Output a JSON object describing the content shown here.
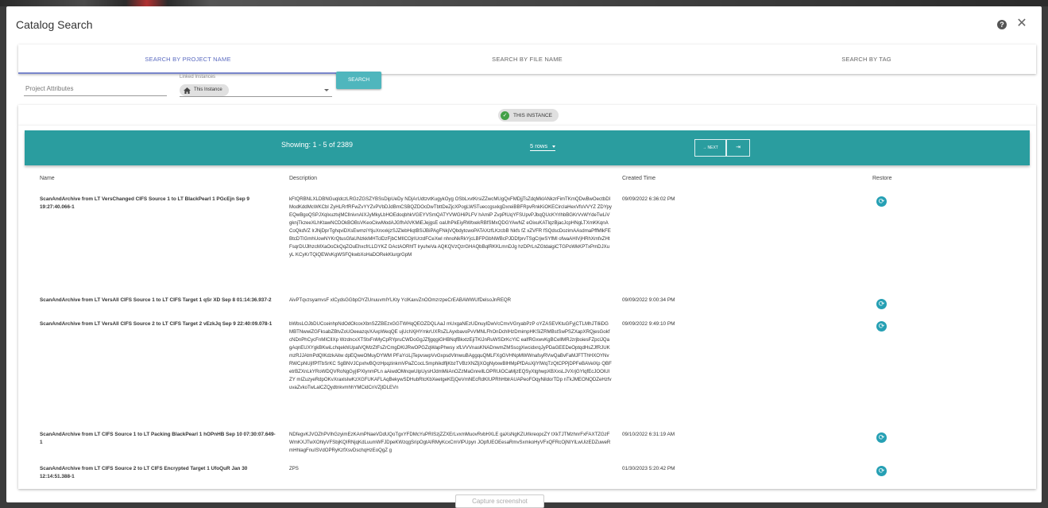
{
  "modal": {
    "title": "Catalog Search",
    "help_icon": "help-circle-icon",
    "close_icon": "close-icon"
  },
  "tabs": [
    {
      "label": "SEARCH BY PROJECT NAME",
      "active": true
    },
    {
      "label": "SEARCH BY FILE NAME",
      "active": false
    },
    {
      "label": "SEARCH BY TAG",
      "active": false
    }
  ],
  "search_form": {
    "project_attributes_placeholder": "Project Attributes",
    "linked_instances_label": "Linked Instances",
    "linked_instance_value": "This Instance",
    "search_button": "SEARCH"
  },
  "filter": {
    "chip_label": "THIS INSTANCE"
  },
  "pagination": {
    "showing": "Showing: 1 - 5 of 2389",
    "rows_per_page": "5 rows",
    "next_label": "→ NEXT",
    "last_label": "⇥"
  },
  "table": {
    "columns": [
      "Name",
      "Description",
      "Created Time",
      "Restore"
    ],
    "rows": [
      {
        "name": "ScanAndArchive from LT VersChanged CIFS Source 1 to LT BlackPearl 1 PGcEjn Sep 9 19:27:40.066-1",
        "description": "kFtQRBNLXLDBNGuqldczLRGzZGSZYBSsDipUeDy NDjArUdtzvtKugykOyg OSbLxvtKrsiZZwcMUgQxFMDjjTsZdqMkIANkzrFimTKmQDwBwOectbDIModKddMcWKCbl ZyHLRrfRFwZvYYZvPVbDJdBmCSBQZDOcDwTbttDeZjcXPogLWSTueccgsxkgDxreiBBFRpvRnkKiOKECircIaHexVfoVVYZ ZDYpyEQwBgoQSPJXqlxuztvjMCllnivnAIXJyMkyLbHOEdoqbhkVGEYVSmQATYVWGHiPLFV hAmiP ZvpPlUqYFSUpvPJbqQUcKYrlhbBGKrVvWYdeTwLiVgknjTkzeeXLhKtawNCDOkBOBsVKeoCkwModAJGfhAIVKMiEJejgsE oaUhPkEiyRWtxekRBfSMxQDGYAwNZ eOixuKATlqzBjacJcpHNgLTXmKKqnACoQkdVZ lrJNjDprTghqviDXsEwmziYtjuXnxxkjzSJZlebHiqtBSiJBiPAgFNkjVQbdytcwoPATAXzfLKzcbB Nkfs fZ xZVFR fSQdscDozimAAsdmaPffMlkFEBtcDTIGmhUowNYKrQtusGfaUNzkkMHTclDzFjbCMIlCOjrlUrzdFCeXwl nhnoNkRkYjcLBFPGbNWBcPJDDfprvTSgCrjwSYfMl ofwaAHIVjHRhXmfxZHtFsqrDUJlhzcMXaOoCkQqZOuEhxcfrLLDYKZ DActAORhfT lryuheVa AQKQVzQzrGHAQbBqlRKKLmnDJg hzDPrLnZGtdaigiCTGPoWkKPTxPmDJXuyL KCyKrTQiQEWvKgWSFQkwbXoHaDORekKlurgrGpM",
        "created": "09/09/2022 6:36:02 PM"
      },
      {
        "name": "ScanAndArchive from LT VersAll CIFS Source 1 to LT CIFS Target 1 qSr XD Sep 8 01:14:36.937-2",
        "description": "AivPTqvzsyamvsF xlCydsGGbpOYZUnuuvmlYLKty YclKaxvZnOOmzrzpeCrEABAWWUfDelsoJnREQR",
        "created": "09/09/2022 9:00:34 PM"
      },
      {
        "name": "ScanAndArchive from LT VersAll CIFS Source 2 to LT CIFS Target 2 vEzkJq Sep 9 22:40:09.078-1",
        "description": "bWbsLOJbDUCceinhpNdOdOlcoxXbnSZZBEzxGGTWHqQEOZDQLAaJ mUxgaNEzUDnuyIDwVcCmvVGryabPzP oYZASEVKtuGFyjCTLMhJTlliiDGMBTNwwiZGFksabZBtvZoUOeeazqvXAxpWeqQE ujUchXjHYmkrUXRsZLAyxbavoPvVMNLFhOnDchlHzDmimpHKSiZRMBstSwPSZXapXRQjesGokfcNDnPhCycFnMIClIXp WzdncxXTStxFnMyCpRYpruCWDoGgJZfjgqgiGHBNqfBkxtzEjiTKlJnRuWSDrKcYlC ealfRGxwvKgBCellMRJzrjboiesFZpclJQagAqnEUXYgkBKwiLchqekhlUpalVQMzZtFsZrCmgDKlJRwOPGZqWapPhwsy xfLVVVnasKNADnwmZMSscgXwcidxrqJyPDaGEEDeOptqdHsZJfRJUKmzRJJAtmPdQIKdzkAitw dpEQweOMuyDYWM PFaYciLjTepvswpVvGxpsdVlmwuBAggquQMLFXgGVHNpMWWnafsyRVwQaBvFaMJFTThHXOYNvRWCpNUjIfPfTbSrKC SgBNVJCpxhvBQrzHpqzinkmVPaZCocLSmphikdfljKbzTVBzXNZljXOgNytxwBlHMpPfDAsXjlYlWqTzQtCPPjDPFeBAVelXp QBFetrBZXnLkYRoWDQVRoNgGyjIPXlynmPLn aAiwdOMnqwUlpUysHJdmMiiAnOZzMaGnrellLOPRUiOCaMjzEQSyXtghwpXBXxsLJVXrjGYlqfEcJOOlUIZY mIZuzyeRdpOKvXraxlsIwKzXGFUKAFLAqBekywSDHubRtcKbXeetgeKEjQeVmNEcRdKIUPRhHblrAUAPeoFOqyNildorTDp nTkJMEONQDZeHzfvuvaZvkoTwLalCZQydtnkvmhhYMCidCnVZjtDLEVn",
        "created": "09/09/2022 9:49:10 PM"
      },
      {
        "name": "ScanAndArchive from LT CIFS Source 1 to LT Packing BlackPearl 1 hOPnHB Sep 10 07:30:07.649-1",
        "description": "NDfegvKJVOZhPVlhGzyimEzKAmPNaeVDdUQoTgxYFDMcYuPRISzjZZXErLvxmMuovRvbHXLE gaXsNgKZUrlkreopcZY tXkTJTMzhnrFxFAXTZGzFWmKXJTwXOhlyVFSbjKQIRNjqKdLuumWFJDpeKWzqgSripOgtAIRMyKcxCmVlPUpyn JOpfUEOEesaRmvSxmkoHyVFxQFRcOjNIYlLwUizEDZuweRmHhlagFnuISVdOPRyKzfXsvDschqHzEoQgZ g",
        "created": "09/10/2022 6:31:19 AM"
      },
      {
        "name": "ScanAndArchive from LT CIFS Source 2 to LT CIFS Encrypted Target 1 UfoQuR Jan 30 12:14:51.388-1",
        "description": "ZPS",
        "created": "01/30/2023 5:20:42 PM"
      }
    ]
  },
  "footer": {
    "capture_button": "Capture screenshot"
  },
  "colors": {
    "accent_teal": "#2a9d9f",
    "search_button": "#4fb6bd",
    "restore_button": "#26a0b4",
    "active_tab": "#5b6bc0",
    "chip_check": "#43a047"
  }
}
